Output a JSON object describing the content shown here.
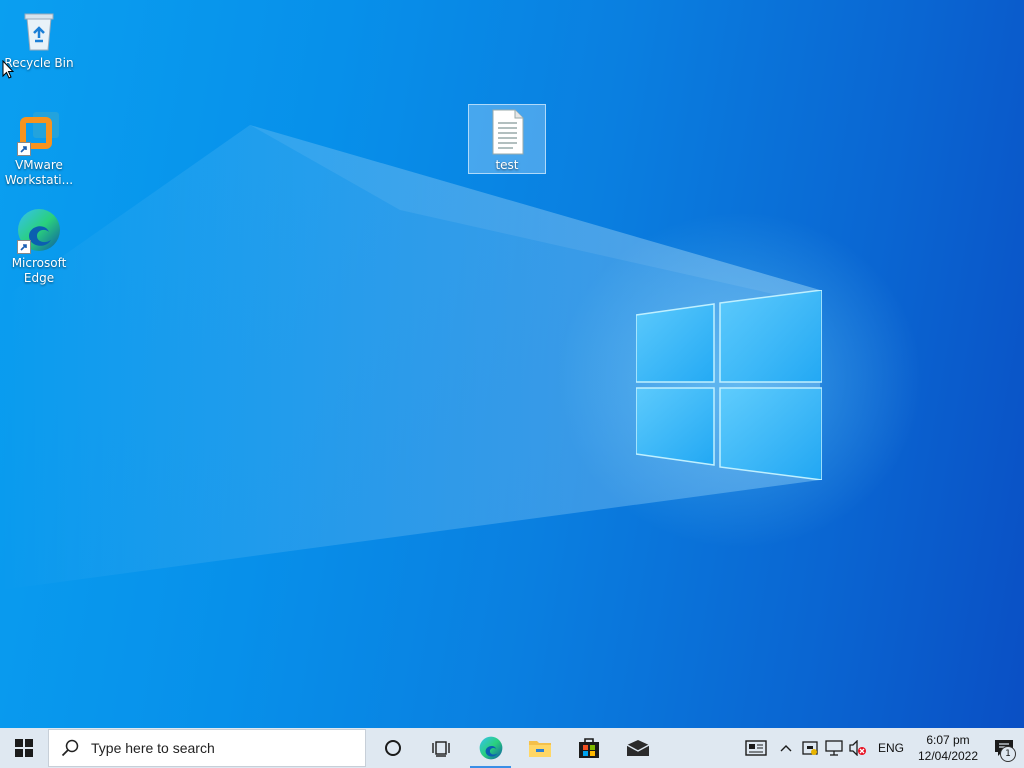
{
  "desktop": {
    "icons": [
      {
        "label": "Recycle Bin"
      },
      {
        "label": "VMware Workstati..."
      },
      {
        "label": "Microsoft Edge"
      },
      {
        "label": "test"
      }
    ]
  },
  "taskbar": {
    "search": {
      "placeholder": "Type here to search"
    },
    "apps": [
      "cortana-icon",
      "task-view-icon",
      "edge-icon",
      "file-explorer-icon",
      "store-icon",
      "mail-icon"
    ],
    "tray": {
      "language": "ENG",
      "time": "6:07 pm",
      "date": "12/04/2022",
      "notification_count": "1"
    }
  },
  "colors": {
    "taskbar_bg": "#dfe8f1",
    "accent": "#3a8ee6"
  }
}
